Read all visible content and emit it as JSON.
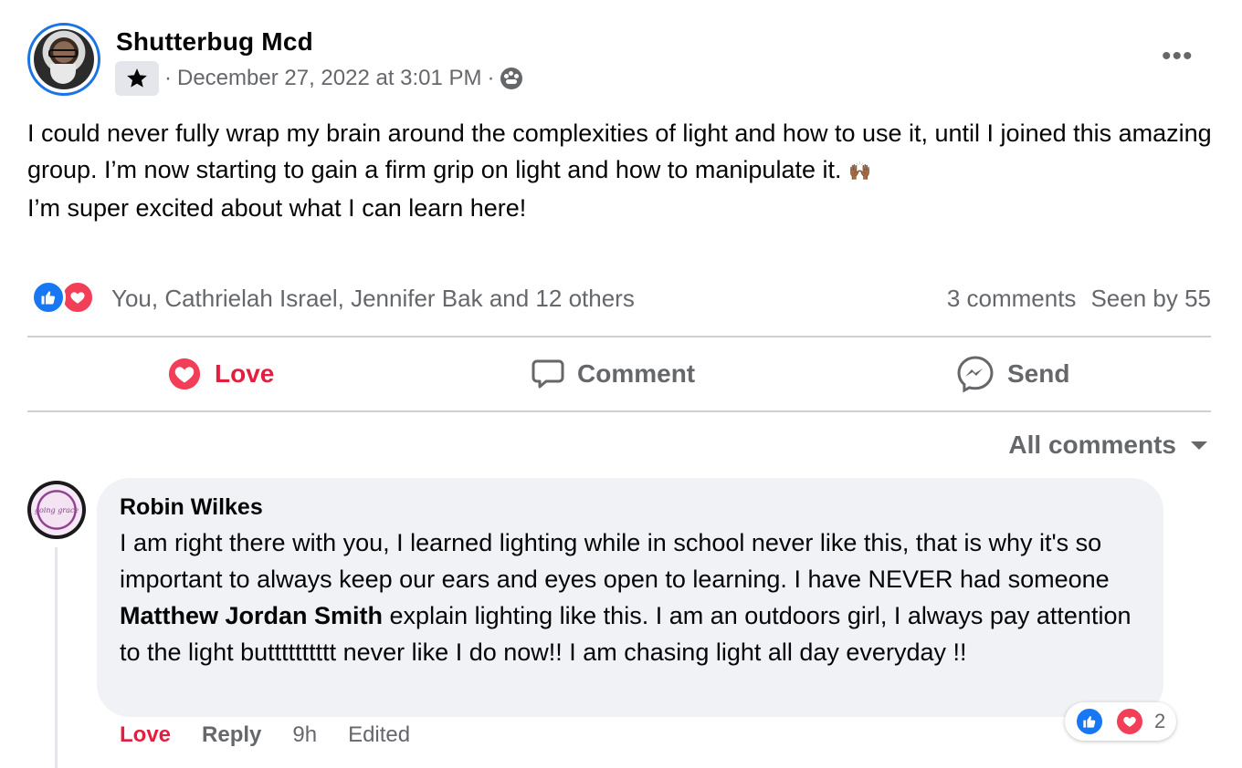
{
  "post": {
    "author": "Shutterbug Mcd",
    "badge_icon": "star-icon",
    "separator": "·",
    "timestamp": "December 27, 2022 at 3:01 PM",
    "separator2": "·",
    "audience_icon": "group-icon",
    "more_label": "•••",
    "text_line1": "I could never fully wrap my brain around the complexities of light and how to use it, until I joined this amazing group. I’m now starting to gain a firm grip on light and how to manipulate it.",
    "emoji": "🙌🏾",
    "text_line2": "I’m super excited about what I can learn here!"
  },
  "reactions": {
    "reactors": "You, Cathrielah Israel, Jennifer Bak and 12 others",
    "comments_count": "3 comments",
    "seen_by": "Seen by 55"
  },
  "actions": {
    "love": "Love",
    "comment": "Comment",
    "send": "Send"
  },
  "comments": {
    "sort_label": "All comments",
    "items": [
      {
        "author": "Robin Wilkes",
        "avatar_text": "going grace",
        "text_before": "I am right there with you, I learned lighting while in school never like this, that is why it's so important to always keep our ears and eyes open to learning. I have NEVER had someone ",
        "mention": "Matthew Jordan Smith",
        "text_after": " explain lighting like this. I am an outdoors girl, I always pay attention to the light butttttttttt never like I do now!! I am chasing light all day everyday !!",
        "love_label": "Love",
        "reply_label": "Reply",
        "time": "9h",
        "edited": "Edited",
        "reaction_count": "2"
      }
    ]
  },
  "colors": {
    "accent_blue": "#1877f2",
    "love_red": "#e41e3f",
    "muted_text": "#65676b",
    "bubble_bg": "#f0f2f5"
  }
}
